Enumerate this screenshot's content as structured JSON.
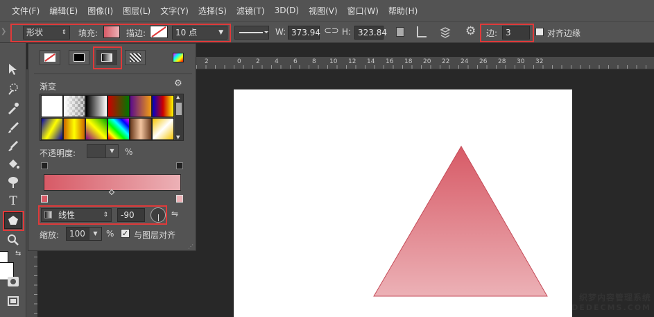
{
  "menubar": {
    "items": [
      "文件(F)",
      "编辑(E)",
      "图像(I)",
      "图层(L)",
      "文字(Y)",
      "选择(S)",
      "滤镜(T)",
      "3D(D)",
      "视图(V)",
      "窗口(W)",
      "帮助(H)"
    ]
  },
  "options": {
    "mode": "形状",
    "fill_label": "填充:",
    "stroke_label": "描边:",
    "stroke_size": "10 点",
    "w_label": "W:",
    "w_value": "373.94",
    "h_label": "H:",
    "h_value": "323.84",
    "sides_label": "边:",
    "sides_value": "3",
    "align_edges": "对齐边缘"
  },
  "ruler": {
    "ticks": [
      "2",
      "0",
      "2",
      "4",
      "6",
      "8",
      "10",
      "12",
      "14",
      "16",
      "18",
      "20",
      "22",
      "24",
      "26",
      "28",
      "30",
      "32"
    ]
  },
  "gradient_panel": {
    "title": "渐变",
    "opacity_label": "不透明度:",
    "opacity_unit": "%",
    "style": "线性",
    "angle": "-90",
    "scale_label": "缩放:",
    "scale_value": "100",
    "scale_unit": "%",
    "align_layer": "与图层对齐",
    "align_checked": true
  },
  "colors": {
    "fill_top": "#d75a66",
    "fill_bottom": "#ecb1b6",
    "highlight": "#e03a3a"
  },
  "watermark": {
    "line1": "织梦内容管理系统",
    "line2": "DEDECMS.COM"
  }
}
